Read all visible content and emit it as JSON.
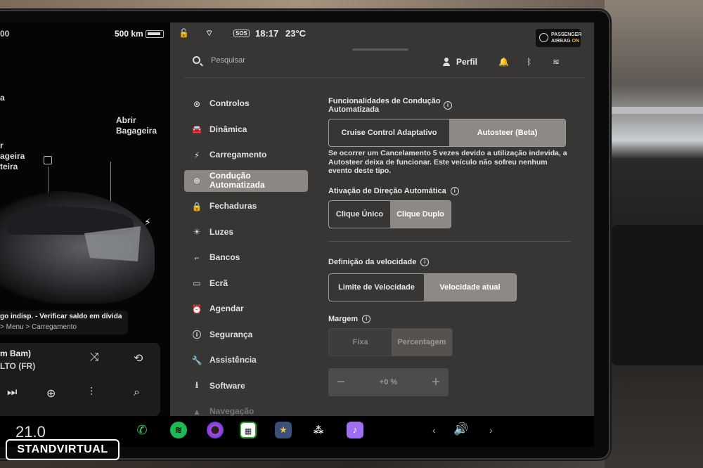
{
  "car": {
    "top_left": "00",
    "range": "500 km",
    "trunk_label": [
      "Abrir",
      "Bagageira"
    ],
    "frunk_label": [
      "r",
      "ageira",
      "teira"
    ],
    "left_edge_label": "a",
    "nav_message": {
      "line1": "go indisp. - Verificar saldo em dívida",
      "line2": "> Menu > Carregamento"
    }
  },
  "media": {
    "song": "m Bam)",
    "artist": "LTO (FR)"
  },
  "status": {
    "time": "18:17",
    "temperature": "23°C",
    "sos": "SOS",
    "airbag_line1": "PASSENGER",
    "airbag_line2": "AIRBAG",
    "airbag_state": "ON"
  },
  "header": {
    "search_placeholder": "Pesquisar",
    "profile_label": "Perfil"
  },
  "menu": [
    {
      "label": "Controlos",
      "icon": "toggle-icon",
      "glyph": "⊙"
    },
    {
      "label": "Dinâmica",
      "icon": "car-icon",
      "glyph": "🚘"
    },
    {
      "label": "Carregamento",
      "icon": "bolt-icon",
      "glyph": "⚡"
    },
    {
      "label": "Condução Automatizada",
      "icon": "steering-wheel-icon",
      "glyph": "⊕"
    },
    {
      "label": "Fechaduras",
      "icon": "lock-icon",
      "glyph": "🔒"
    },
    {
      "label": "Luzes",
      "icon": "sun-icon",
      "glyph": "☀"
    },
    {
      "label": "Bancos",
      "icon": "seat-icon",
      "glyph": "⌐"
    },
    {
      "label": "Ecrã",
      "icon": "display-icon",
      "glyph": "▭"
    },
    {
      "label": "Agendar",
      "icon": "alarm-icon",
      "glyph": "⏰"
    },
    {
      "label": "Segurança",
      "icon": "info-icon",
      "glyph": "ⓘ"
    },
    {
      "label": "Assistência",
      "icon": "wrench-icon",
      "glyph": "🔧"
    },
    {
      "label": "Software",
      "icon": "download-icon",
      "glyph": "⭳"
    },
    {
      "label": "Navegação",
      "icon": "navigation-icon",
      "glyph": "▲"
    }
  ],
  "autopilot": {
    "features_title": "Funcionalidades de Condução Automatizada",
    "features_options": [
      "Cruise Control Adaptativo",
      "Autosteer (Beta)"
    ],
    "features_selected": 1,
    "features_note": "Se ocorrer um Cancelamento 5 vezes devido a utilização indevida, a Autosteer deixa de funcionar. Este veículo não sofreu nenhum evento deste tipo.",
    "activation_title": "Ativação de Direção Automática",
    "activation_options": [
      "Clique Único",
      "Clique Duplo"
    ],
    "activation_selected": 1,
    "speed_title": "Definição da velocidade",
    "speed_options": [
      "Limite de Velocidade",
      "Velocidade atual"
    ],
    "speed_selected": 1,
    "margin_title": "Margem",
    "margin_options": [
      "Fixa",
      "Percentagem"
    ],
    "margin_selected": 1,
    "offset_value": "+0 %",
    "minus": "−",
    "plus": "+"
  },
  "dock": {
    "temperature": "21.0",
    "apps": [
      "phone-icon",
      "spotify-icon",
      "camera-icon",
      "toybox-icon",
      "games-icon",
      "tidal-icon",
      "karaoke-icon"
    ]
  },
  "watermark": "STANDVIRTUAL",
  "colors": {
    "panel_bg": "#383634",
    "selected": "#8d8a86",
    "airbag_on": "#e4b33a",
    "phone": "#2bd36b",
    "spotify": "#1db954"
  }
}
